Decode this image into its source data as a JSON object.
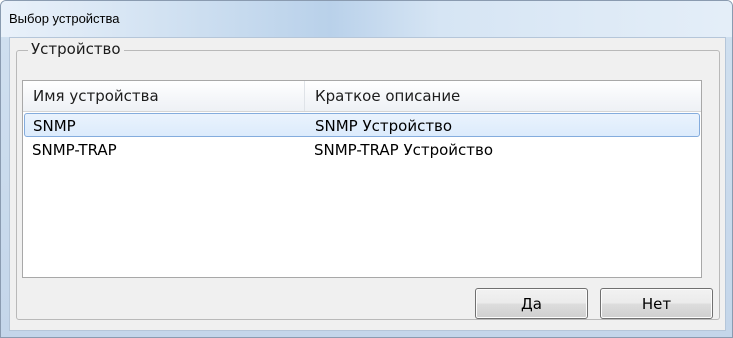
{
  "window": {
    "title": "Выбор устройства"
  },
  "group": {
    "legend": "Устройство"
  },
  "list": {
    "columns": [
      "Имя устройства",
      "Краткое описание"
    ],
    "rows": [
      {
        "name": "SNMP",
        "description": "SNMP Устройство",
        "selected": true
      },
      {
        "name": "SNMP-TRAP",
        "description": "SNMP-TRAP Устройство",
        "selected": false
      }
    ]
  },
  "buttons": {
    "yes_label": "Да",
    "no_label": "Нет"
  },
  "colors": {
    "selection_fill": "#dcebfc",
    "selection_border": "#84acdd",
    "titlebar_accent": "#b9d1ea"
  }
}
